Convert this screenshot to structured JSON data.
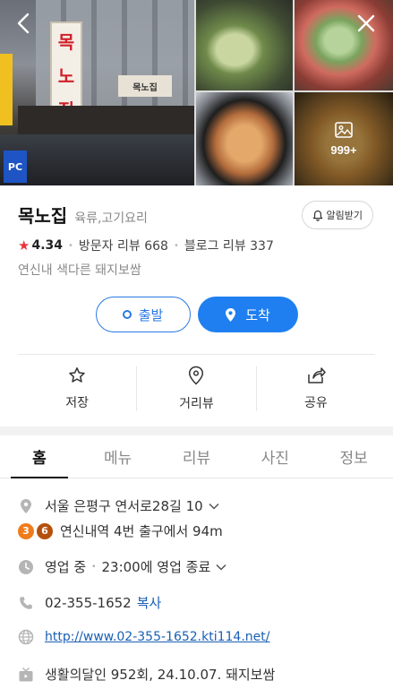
{
  "header": {
    "back_icon": "chevron-left-icon",
    "close_icon": "close-icon",
    "photo_count": "999+",
    "photo_signs": {
      "vertical_sign": [
        "목",
        "노",
        "집"
      ],
      "pc_sign": "PC"
    }
  },
  "place": {
    "name": "목노집",
    "category": "육류,고기요리",
    "alert_label": "알림받기",
    "rating": "4.34",
    "visitor_reviews": "방문자 리뷰 668",
    "blog_reviews": "블로그 리뷰 337",
    "description": "연신내 색다른 돼지보쌈"
  },
  "route": {
    "start_label": "출발",
    "arrive_label": "도착"
  },
  "actions": [
    {
      "label": "저장",
      "icon": "star-outline-icon"
    },
    {
      "label": "거리뷰",
      "icon": "location-pin-icon"
    },
    {
      "label": "공유",
      "icon": "share-icon"
    }
  ],
  "tabs": [
    {
      "label": "홈",
      "active": true
    },
    {
      "label": "메뉴",
      "active": false
    },
    {
      "label": "리뷰",
      "active": false
    },
    {
      "label": "사진",
      "active": false
    },
    {
      "label": "정보",
      "active": false
    }
  ],
  "details": {
    "address": "서울 은평구 연서로28길 10",
    "subway_lines": [
      {
        "line": "3",
        "color": "#ef7c1c"
      },
      {
        "line": "6",
        "color": "#b5500b"
      }
    ],
    "subway_text": "연신내역 4번 출구에서 94m",
    "hours_status": "영업 중",
    "hours_end": "23:00에 영업 종료",
    "phone": "02-355-1652",
    "copy_label": "복사",
    "website": "http://www.02-355-1652.kti114.net/",
    "tv_info": "생활의달인 952회, 24.10.07. 돼지보쌈"
  },
  "colors": {
    "accent_blue": "#1f7ff0",
    "star_red": "#e8323c",
    "link_blue": "#1a5fb4"
  }
}
